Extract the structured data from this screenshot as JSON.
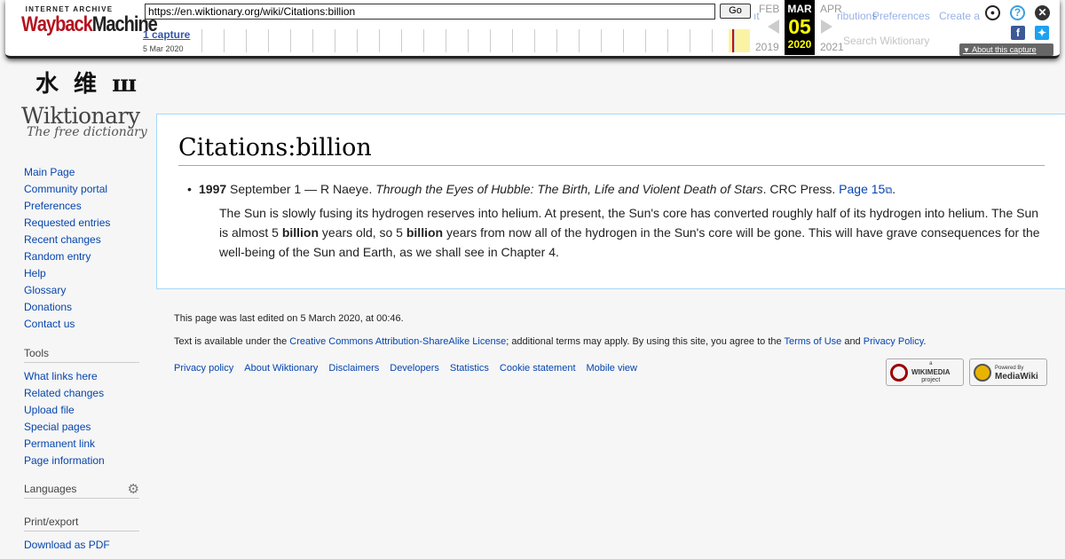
{
  "wayback": {
    "logo_top": "INTERNET ARCHIVE",
    "logo_letters": [
      "W",
      "a",
      "y",
      "b",
      "a",
      "c",
      "k",
      "M",
      "a",
      "c",
      "h",
      "i",
      "n",
      "e"
    ],
    "url": "https://en.wiktionary.org/wiki/Citations:billion",
    "go_label": "Go",
    "captures_label": "1 capture",
    "capture_date": "5 Mar 2020",
    "prev_month": "FEB",
    "cur_month": "MAR",
    "next_month": "APR",
    "cur_day": "05",
    "prev_year": "2019",
    "cur_year": "2020",
    "next_year": "2021",
    "about_label": "About this capture",
    "colors": {
      "wayback_red": "#b4131f",
      "highlight": "#fbf3a4",
      "cur_bg": "#000000",
      "cur_fg": "#ffff00"
    }
  },
  "ghost": {
    "contrib": "ributions",
    "prefs": "Preferences",
    "create": "Create a",
    "search": "Search Wiktionary",
    "it": "ıt"
  },
  "logo": {
    "glyphs": "水 维 ш",
    "name": "Wiktionary",
    "tagline": "The free dictionary"
  },
  "sidebar": {
    "navigation": [
      "Main Page",
      "Community portal",
      "Preferences",
      "Requested entries",
      "Recent changes",
      "Random entry",
      "Help",
      "Glossary",
      "Donations",
      "Contact us"
    ],
    "tools_heading": "Tools",
    "tools": [
      "What links here",
      "Related changes",
      "Upload file",
      "Special pages",
      "Permanent link",
      "Page information"
    ],
    "languages_heading": "Languages",
    "print_heading": "Print/export",
    "print": [
      "Download as PDF"
    ]
  },
  "article": {
    "title": "Citations:billion",
    "year": "1997",
    "date_author": " September 1 — R Naeye. ",
    "work": "Through the Eyes of Hubble: The Birth, Life and Violent Death of Stars",
    "publisher": ". CRC Press. ",
    "page_link": "Page 15",
    "quote_1": "The Sun is slowly fusing its hydrogen reserves into helium. At present, the Sun's core has converted roughly half of its hydrogen into helium. The Sun is almost 5 ",
    "term": "billion",
    "quote_2": " years old, so 5 ",
    "quote_3": " years from now all of the hydrogen in the Sun's core will be gone. This will have grave consequences for the well-being of the Sun and Earth, as we shall see in Chapter 4."
  },
  "footer": {
    "edited": "This page was last edited on 5 March 2020, at 00:46.",
    "lic_1": "Text is available under the ",
    "lic_link": "Creative Commons Attribution-ShareAlike License",
    "lic_2": "; additional terms may apply. By using this site, you agree to the ",
    "terms": "Terms of Use",
    "and": " and ",
    "privacy": "Privacy Policy",
    "period": ".",
    "links": [
      "Privacy policy",
      "About Wiktionary",
      "Disclaimers",
      "Developers",
      "Statistics",
      "Cookie statement",
      "Mobile view"
    ],
    "badge_wikimedia_top": "a",
    "badge_wikimedia": "WIKIMEDIA",
    "badge_wikimedia_sub": "project",
    "badge_mediawiki_top": "Powered By",
    "badge_mediawiki": "MediaWiki"
  }
}
